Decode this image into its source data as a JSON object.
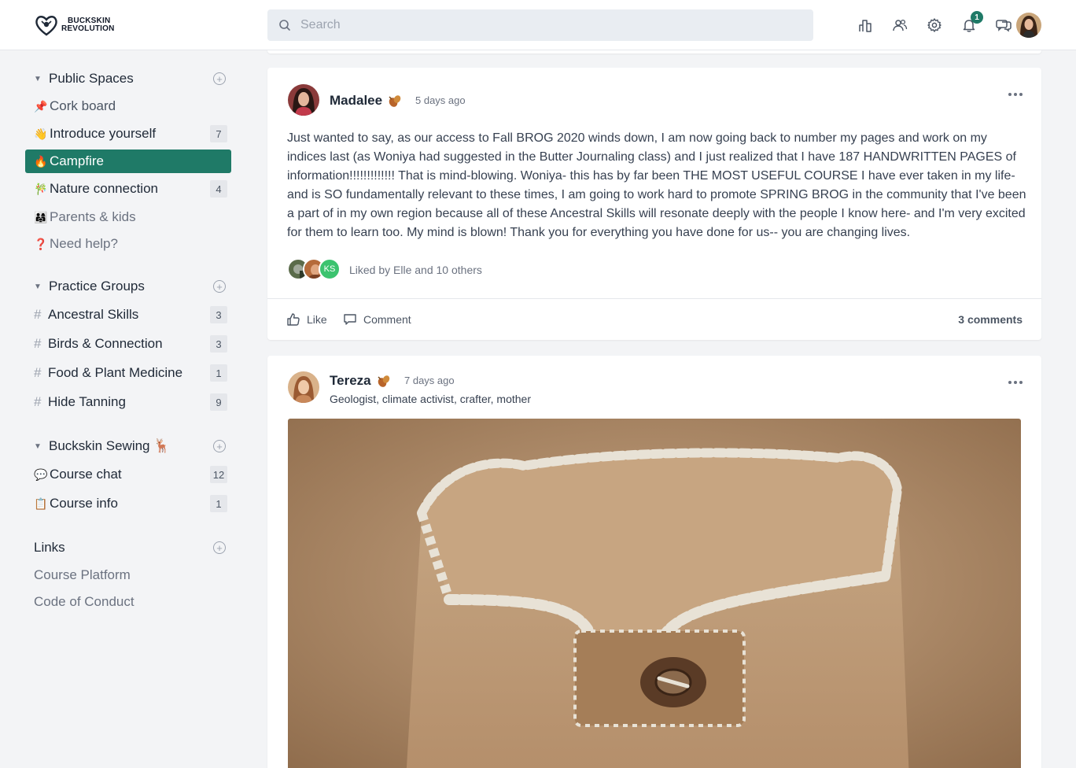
{
  "header": {
    "logo_line1": "BUCKSKIN",
    "logo_line2": "REVOLUTION",
    "search_placeholder": "Search",
    "notifications_count": "1",
    "icons": [
      "leaderboard-icon",
      "members-icon",
      "settings-icon",
      "notifications-icon",
      "chat-icon"
    ]
  },
  "sidebar": {
    "public_spaces": {
      "title": "Public Spaces",
      "items": [
        {
          "emoji": "📌",
          "label": "Cork board",
          "count": ""
        },
        {
          "emoji": "👋",
          "label": "Introduce yourself",
          "count": "7"
        },
        {
          "emoji": "🔥",
          "label": "Campfire",
          "count": ""
        },
        {
          "emoji": "🎋",
          "label": "Nature connection",
          "count": "4"
        },
        {
          "emoji": "👨‍👩‍👧",
          "label": "Parents & kids",
          "count": ""
        },
        {
          "emoji": "❓",
          "label": "Need help?",
          "count": ""
        }
      ]
    },
    "practice_groups": {
      "title": "Practice Groups",
      "items": [
        {
          "label": "Ancestral Skills",
          "count": "3"
        },
        {
          "label": "Birds & Connection",
          "count": "3"
        },
        {
          "label": "Food & Plant Medicine",
          "count": "1"
        },
        {
          "label": "Hide Tanning",
          "count": "9"
        }
      ]
    },
    "buckskin_sewing": {
      "title": "Buckskin Sewing 🦌",
      "items": [
        {
          "emoji": "💬",
          "label": "Course chat",
          "count": "12"
        },
        {
          "emoji": "📋",
          "label": "Course info",
          "count": "1"
        }
      ]
    },
    "links": {
      "title": "Links",
      "items": [
        "Course Platform",
        "Code of Conduct"
      ]
    }
  },
  "posts": [
    {
      "author": "Madalee",
      "time": "5 days ago",
      "body": "Just wanted to say, as our access to Fall BROG 2020 winds down, I am now going back to number my pages and work on my indices last (as Woniya had suggested in the Butter Journaling class) and I just realized that I have 187 HANDWRITTEN PAGES of information!!!!!!!!!!!!! That is mind-blowing. Woniya- this has by far been THE MOST USEFUL COURSE I have ever taken in my life- and is SO fundamentally relevant to these times, I am going to work hard to promote SPRING BROG in the community that I've been a part of in my own region because all of these Ancestral Skills will resonate deeply with the people I know here- and I'm very excited for them to learn too. My mind is blown! Thank you for everything you have done for us-- you are changing lives.",
      "liker_initials": "KS",
      "liked_by": "Liked by Elle and 10 others",
      "like_label": "Like",
      "comment_label": "Comment",
      "comments_count": "3 comments"
    },
    {
      "author": "Tereza",
      "time": "7 days ago",
      "bio": "Geologist, climate activist, crafter, mother"
    }
  ],
  "colors": {
    "accent": "#1f7a67",
    "badge": "#1f7a67",
    "liker_ks": "#3cc36f"
  }
}
